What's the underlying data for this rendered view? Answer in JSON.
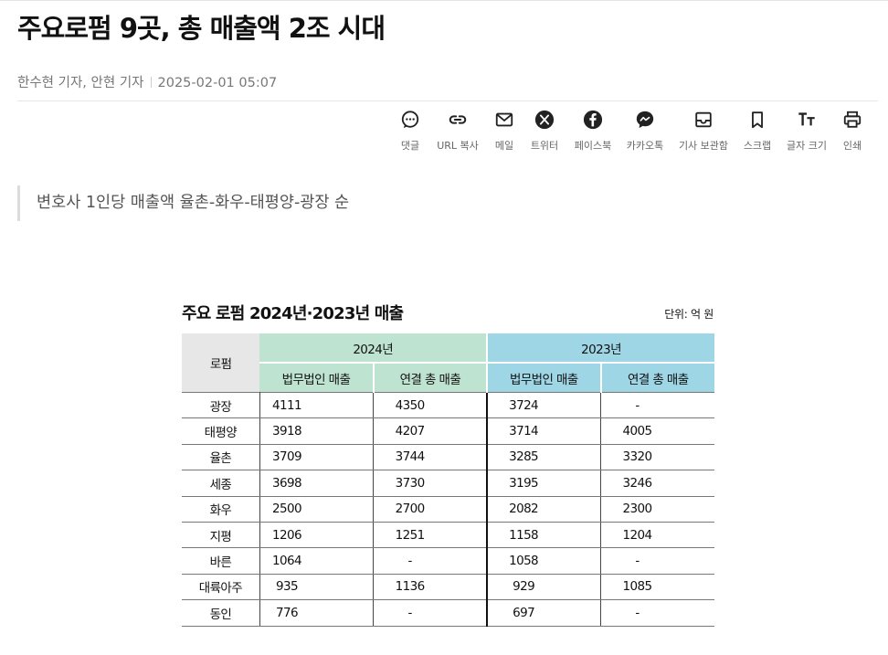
{
  "article": {
    "headline": "주요로펌 9곳, 총 매출액 2조 시대",
    "byline": "한수현 기자, 안현 기자",
    "datetime": "2025-02-01 05:07",
    "subheadline": "변호사 1인당 매출액 율촌-화우-태평양-광장 순"
  },
  "share": [
    {
      "label": "댓글",
      "icon": "comment-icon"
    },
    {
      "label": "URL 복사",
      "icon": "link-icon"
    },
    {
      "label": "메일",
      "icon": "mail-icon"
    },
    {
      "label": "트위터",
      "icon": "x-twitter-icon"
    },
    {
      "label": "페이스북",
      "icon": "facebook-icon"
    },
    {
      "label": "카카오톡",
      "icon": "kakaotalk-icon"
    },
    {
      "label": "기사 보관함",
      "icon": "archive-tray-icon"
    },
    {
      "label": "스크랩",
      "icon": "bookmark-icon"
    },
    {
      "label": "글자 크기",
      "icon": "text-size-icon"
    },
    {
      "label": "인쇄",
      "icon": "print-icon"
    }
  ],
  "figure": {
    "title": "주요 로펌 2024년·2023년 매출",
    "unit": "단위: 억 원",
    "table": {
      "corner": "로펌",
      "years": [
        "2024년",
        "2023년"
      ],
      "subcolumns": [
        "법무법인 매출",
        "연결 총 매출",
        "법무법인 매출",
        "연결 총 매출"
      ],
      "rows": [
        {
          "firm": "광장",
          "v2024_firm": "4111",
          "v2024_total": "4350",
          "v2023_firm": "3724",
          "v2023_total": "-"
        },
        {
          "firm": "태평양",
          "v2024_firm": "3918",
          "v2024_total": "4207",
          "v2023_firm": "3714",
          "v2023_total": "4005"
        },
        {
          "firm": "율촌",
          "v2024_firm": "3709",
          "v2024_total": "3744",
          "v2023_firm": "3285",
          "v2023_total": "3320"
        },
        {
          "firm": "세종",
          "v2024_firm": "3698",
          "v2024_total": "3730",
          "v2023_firm": "3195",
          "v2023_total": "3246"
        },
        {
          "firm": "화우",
          "v2024_firm": "2500",
          "v2024_total": "2700",
          "v2023_firm": "2082",
          "v2023_total": "2300"
        },
        {
          "firm": "지평",
          "v2024_firm": "1206",
          "v2024_total": "1251",
          "v2023_firm": "1158",
          "v2023_total": "1204"
        },
        {
          "firm": "바른",
          "v2024_firm": "1064",
          "v2024_total": "-",
          "v2023_firm": "1058",
          "v2023_total": "-"
        },
        {
          "firm": "대륙아주",
          "v2024_firm": "935",
          "v2024_total": "1136",
          "v2023_firm": "929",
          "v2023_total": "1085"
        },
        {
          "firm": "동인",
          "v2024_firm": "776",
          "v2024_total": "-",
          "v2023_firm": "697",
          "v2023_total": "-"
        }
      ]
    }
  },
  "colors": {
    "header_2024": "#bfe3d1",
    "header_2023": "#9fd6e6",
    "header_corner": "#e7e7e7"
  }
}
